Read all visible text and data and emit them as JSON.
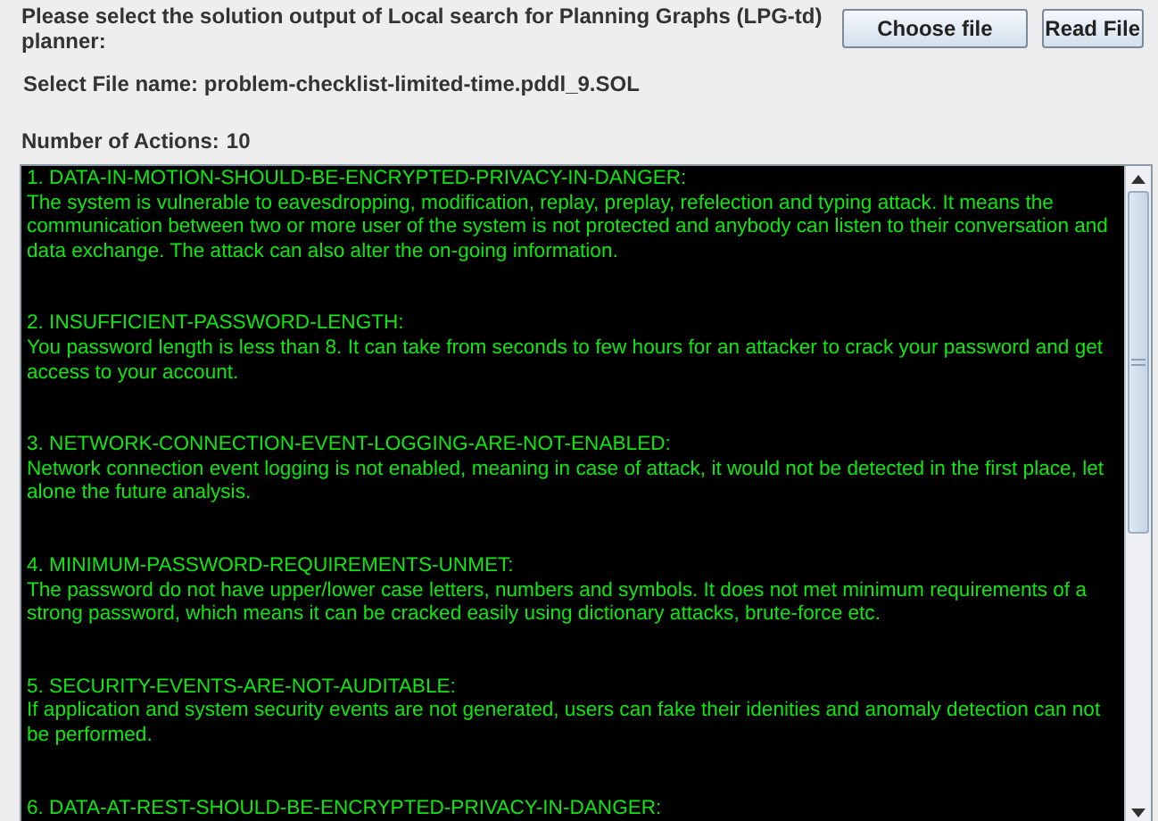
{
  "prompt": "Please select the solution output of Local search for Planning Graphs (LPG-td) planner:",
  "buttons": [
    {
      "label": "Choose file"
    },
    {
      "label": "Read File"
    }
  ],
  "file_label": "Select File name: problem-checklist-limited-time.pddl_9.SOL",
  "actions_label": "Number of Actions:",
  "actions_count": "10",
  "entries": [
    {
      "title": "1. DATA-IN-MOTION-SHOULD-BE-ENCRYPTED-PRIVACY-IN-DANGER:",
      "description": "The system is vulnerable to eavesdropping, modification, replay, preplay, refelection and typing attack. It means the communication between two or more user of the system is not protected and anybody can listen to their conversation and data exchange. The attack can also alter the on-going information."
    },
    {
      "title": "2. INSUFFICIENT-PASSWORD-LENGTH:",
      "description": "You password length is less than 8. It can take from seconds to few hours for an attacker to crack your password and get access to your account."
    },
    {
      "title": "3. NETWORK-CONNECTION-EVENT-LOGGING-ARE-NOT-ENABLED:",
      "description": "Network connection event logging is not enabled, meaning in case of attack, it would not be detected in the first place, let alone the future analysis."
    },
    {
      "title": "4. MINIMUM-PASSWORD-REQUIREMENTS-UNMET:",
      "description": "The password do not have upper/lower case letters, numbers and symbols. It does not met minimum requirements of a strong password, which means it can be cracked easily using dictionary attacks, brute-force etc."
    },
    {
      "title": "5. SECURITY-EVENTS-ARE-NOT-AUDITABLE:",
      "description": "If application and system security events are not generated, users can fake their idenities and anomaly detection can not be performed."
    },
    {
      "title": "6. DATA-AT-REST-SHOULD-BE-ENCRYPTED-PRIVACY-IN-DANGER:"
    }
  ]
}
